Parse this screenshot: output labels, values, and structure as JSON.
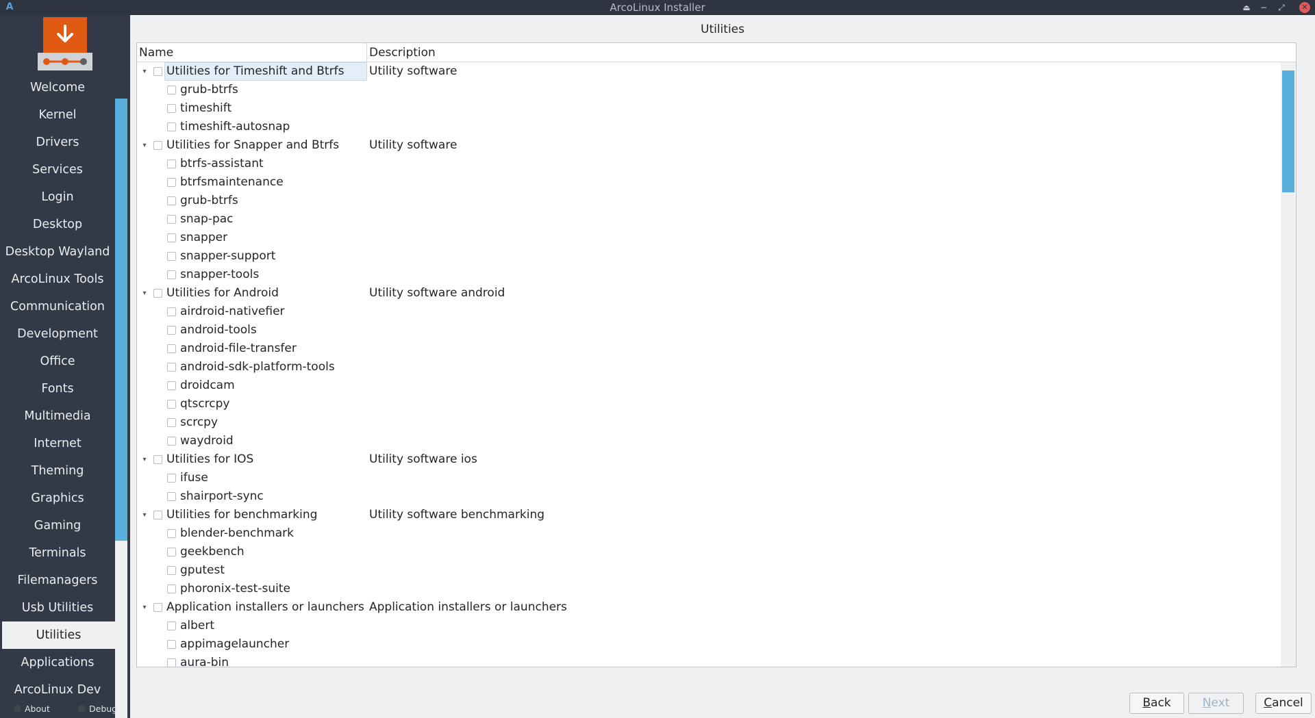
{
  "window": {
    "title": "ArcoLinux Installer",
    "logo_glyph": "A",
    "controls": [
      {
        "name": "keep-above-icon",
        "glyph": "⏏"
      },
      {
        "name": "minimize-icon",
        "glyph": "−"
      },
      {
        "name": "maximize-icon",
        "glyph": "⤢"
      },
      {
        "name": "close-icon",
        "glyph": "✕"
      }
    ]
  },
  "sidebar": {
    "items": [
      {
        "label": "Welcome"
      },
      {
        "label": "Kernel"
      },
      {
        "label": "Drivers"
      },
      {
        "label": "Services"
      },
      {
        "label": "Login"
      },
      {
        "label": "Desktop"
      },
      {
        "label": "Desktop Wayland"
      },
      {
        "label": "ArcoLinux Tools"
      },
      {
        "label": "Communication"
      },
      {
        "label": "Development"
      },
      {
        "label": "Office"
      },
      {
        "label": "Fonts"
      },
      {
        "label": "Multimedia"
      },
      {
        "label": "Internet"
      },
      {
        "label": "Theming"
      },
      {
        "label": "Graphics"
      },
      {
        "label": "Gaming"
      },
      {
        "label": "Terminals"
      },
      {
        "label": "Filemanagers"
      },
      {
        "label": "Usb Utilities"
      },
      {
        "label": "Utilities",
        "active": true
      },
      {
        "label": "Applications"
      },
      {
        "label": "ArcoLinux Dev"
      }
    ],
    "footer": {
      "about_label": "About",
      "debug_label": "Debug"
    },
    "accent": "#e05a14"
  },
  "main": {
    "page_title": "Utilities",
    "columns": {
      "name": "Name",
      "description": "Description"
    },
    "rows": [
      {
        "type": "group",
        "name": "Utilities for Timeshift and Btrfs",
        "description": "Utility software",
        "selected": true
      },
      {
        "type": "child",
        "name": "grub-btrfs"
      },
      {
        "type": "child",
        "name": "timeshift"
      },
      {
        "type": "child",
        "name": "timeshift-autosnap"
      },
      {
        "type": "group",
        "name": "Utilities for Snapper and Btrfs",
        "description": "Utility software"
      },
      {
        "type": "child",
        "name": "btrfs-assistant"
      },
      {
        "type": "child",
        "name": "btrfsmaintenance"
      },
      {
        "type": "child",
        "name": "grub-btrfs"
      },
      {
        "type": "child",
        "name": "snap-pac"
      },
      {
        "type": "child",
        "name": "snapper"
      },
      {
        "type": "child",
        "name": "snapper-support"
      },
      {
        "type": "child",
        "name": "snapper-tools"
      },
      {
        "type": "group",
        "name": "Utilities for Android",
        "description": "Utility software android"
      },
      {
        "type": "child",
        "name": "airdroid-nativefier"
      },
      {
        "type": "child",
        "name": "android-tools"
      },
      {
        "type": "child",
        "name": "android-file-transfer"
      },
      {
        "type": "child",
        "name": "android-sdk-platform-tools"
      },
      {
        "type": "child",
        "name": "droidcam"
      },
      {
        "type": "child",
        "name": "qtscrcpy"
      },
      {
        "type": "child",
        "name": "scrcpy"
      },
      {
        "type": "child",
        "name": "waydroid"
      },
      {
        "type": "group",
        "name": "Utilities for IOS",
        "description": "Utility software ios"
      },
      {
        "type": "child",
        "name": "ifuse"
      },
      {
        "type": "child",
        "name": "shairport-sync"
      },
      {
        "type": "group",
        "name": "Utilities for benchmarking",
        "description": "Utility software benchmarking"
      },
      {
        "type": "child",
        "name": "blender-benchmark"
      },
      {
        "type": "child",
        "name": "geekbench"
      },
      {
        "type": "child",
        "name": "gputest"
      },
      {
        "type": "child",
        "name": "phoronix-test-suite"
      },
      {
        "type": "group",
        "name": "Application installers or launchers",
        "description": "Application installers or launchers"
      },
      {
        "type": "child",
        "name": "albert"
      },
      {
        "type": "child",
        "name": "appimagelauncher"
      },
      {
        "type": "child",
        "name": "aura-bin"
      }
    ]
  },
  "buttons": {
    "back": "Back",
    "next": "Next",
    "cancel": "Cancel"
  }
}
